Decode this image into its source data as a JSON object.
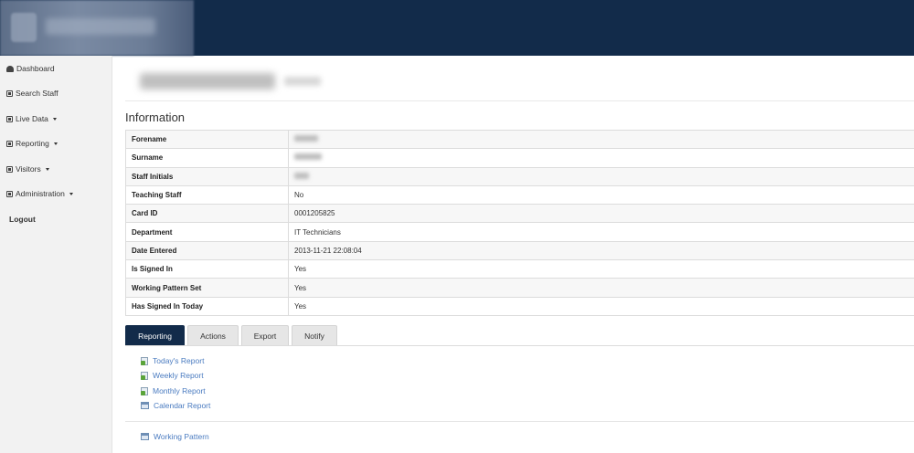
{
  "sidebar": {
    "items": [
      {
        "label": "Dashboard",
        "icon": "dashboard-icon",
        "dropdown": false
      },
      {
        "label": "Search Staff",
        "icon": "search-staff-icon",
        "dropdown": false
      },
      {
        "label": "Live Data",
        "icon": "live-data-icon",
        "dropdown": true
      },
      {
        "label": "Reporting",
        "icon": "reporting-icon",
        "dropdown": true
      },
      {
        "label": "Visitors",
        "icon": "visitors-icon",
        "dropdown": true
      },
      {
        "label": "Administration",
        "icon": "administration-icon",
        "dropdown": true
      }
    ],
    "logout": "Logout"
  },
  "main": {
    "section_title": "Information",
    "rows": [
      {
        "key": "Forename",
        "value": ""
      },
      {
        "key": "Surname",
        "value": ""
      },
      {
        "key": "Staff Initials",
        "value": ""
      },
      {
        "key": "Teaching Staff",
        "value": "No"
      },
      {
        "key": "Card ID",
        "value": "0001205825"
      },
      {
        "key": "Department",
        "value": "IT Technicians"
      },
      {
        "key": "Date Entered",
        "value": "2013-11-21 22:08:04"
      },
      {
        "key": "Is Signed In",
        "value": "Yes"
      },
      {
        "key": "Working Pattern Set",
        "value": "Yes"
      },
      {
        "key": "Has Signed In Today",
        "value": "Yes"
      }
    ],
    "tabs": [
      {
        "label": "Reporting",
        "active": true
      },
      {
        "label": "Actions",
        "active": false
      },
      {
        "label": "Export",
        "active": false
      },
      {
        "label": "Notify",
        "active": false
      }
    ],
    "report_links": [
      {
        "label": "Today's Report",
        "icon": "report-doc-icon"
      },
      {
        "label": "Weekly Report",
        "icon": "report-doc-icon"
      },
      {
        "label": "Monthly Report",
        "icon": "report-doc-icon"
      },
      {
        "label": "Calendar Report",
        "icon": "calendar-icon"
      }
    ],
    "pattern_link": {
      "label": "Working Pattern",
      "icon": "calendar-icon"
    }
  },
  "colors": {
    "header_bg": "#122b4a",
    "link": "#4a7bc0",
    "active_tab": "#122b4a"
  }
}
